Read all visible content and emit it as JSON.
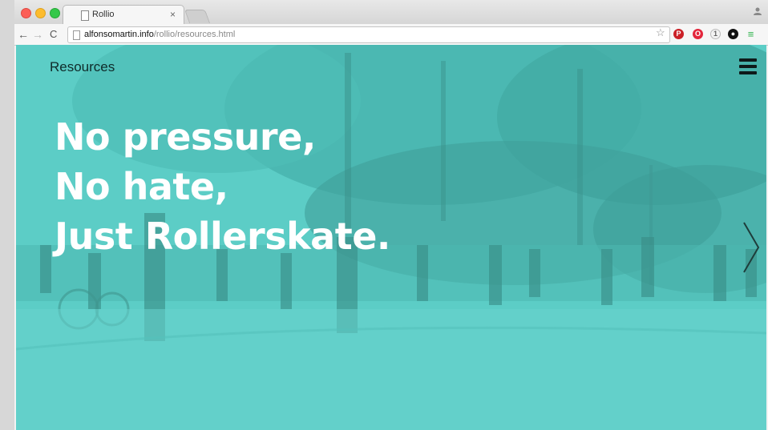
{
  "browser": {
    "tab_title": "Rollio",
    "tab_close": "×",
    "url_host": "alfonsomartin.info",
    "url_path": "/rollio/resources.html",
    "nav": {
      "back": "←",
      "forward": "→",
      "reload": "C"
    },
    "star": "☆",
    "extensions": [
      {
        "name": "pinterest-icon",
        "glyph": "P"
      },
      {
        "name": "opera-icon",
        "glyph": "O"
      },
      {
        "name": "circle-extension-icon",
        "glyph": "1"
      },
      {
        "name": "dark-circle-extension-icon",
        "glyph": "●"
      },
      {
        "name": "menu-icon",
        "glyph": "≡"
      }
    ],
    "colors": {
      "close": "#fc5f57",
      "minimize": "#fdbc2e",
      "maximize": "#34c84a"
    }
  },
  "site": {
    "brand": "Resources",
    "headline": [
      "No pressure,",
      "No hate,",
      "Just Rollerskate."
    ],
    "overlay_color": "#5ccdc6",
    "menu_icon": "hamburger-menu-icon",
    "next_icon": "chevron-right-icon"
  }
}
